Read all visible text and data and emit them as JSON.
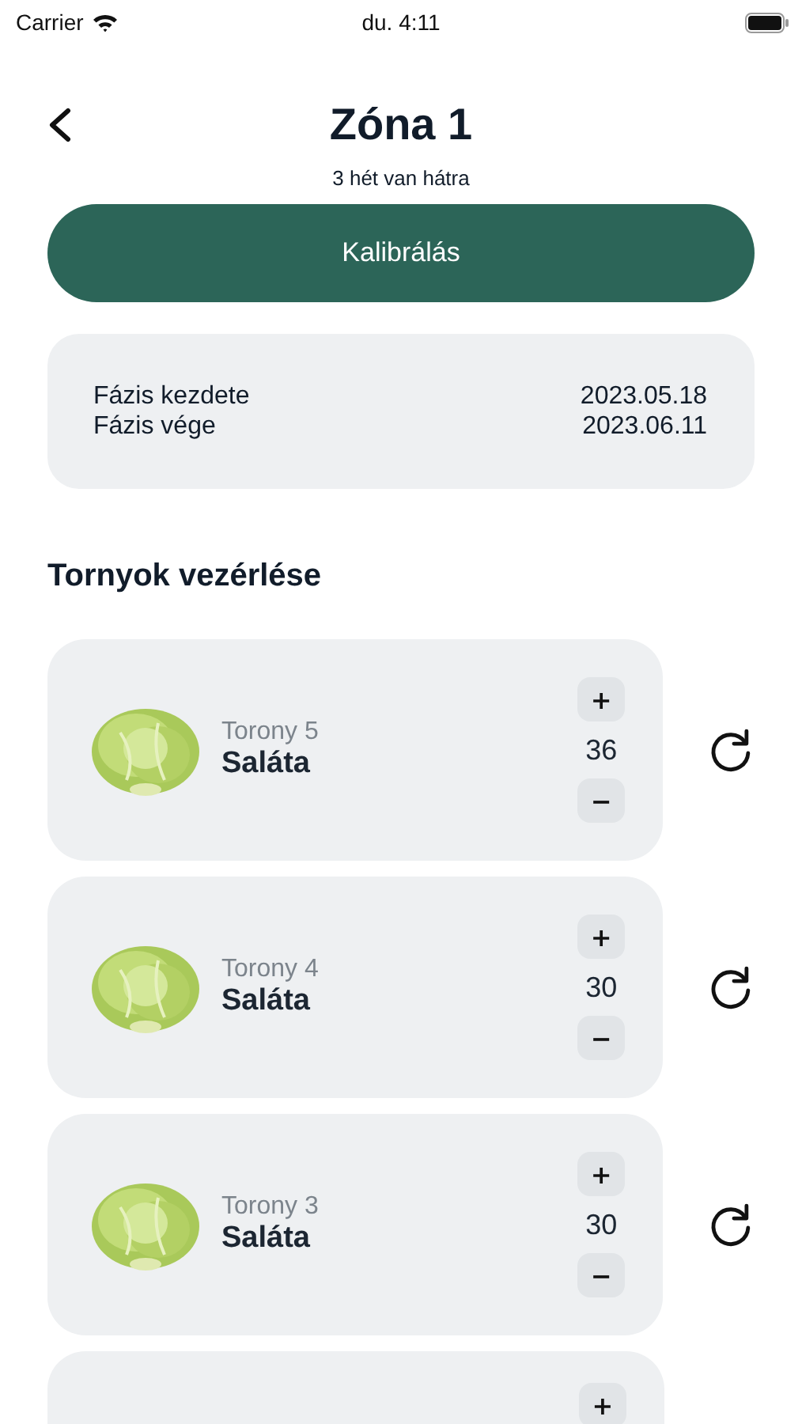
{
  "status_bar": {
    "carrier": "Carrier",
    "time": "du. 4:11"
  },
  "header": {
    "title": "Zóna 1",
    "subtitle": "3 hét van hátra"
  },
  "calibrate_button": "Kalibrálás",
  "phase": [
    {
      "label": "Fázis kezdete",
      "value": "2023.05.18"
    },
    {
      "label": "Fázis vége",
      "value": "2023.06.11"
    }
  ],
  "section_title": "Tornyok vezérlése",
  "towers": [
    {
      "kind": "full",
      "name": "Torony 5",
      "plant": "Saláta",
      "count": "36",
      "plus": "+",
      "minus": "−"
    },
    {
      "kind": "full",
      "name": "Torony 4",
      "plant": "Saláta",
      "count": "30",
      "plus": "+",
      "minus": "−"
    },
    {
      "kind": "full",
      "name": "Torony 3",
      "plant": "Saláta",
      "count": "30",
      "plus": "+",
      "minus": "−"
    },
    {
      "kind": "cut",
      "plus": "+"
    }
  ]
}
